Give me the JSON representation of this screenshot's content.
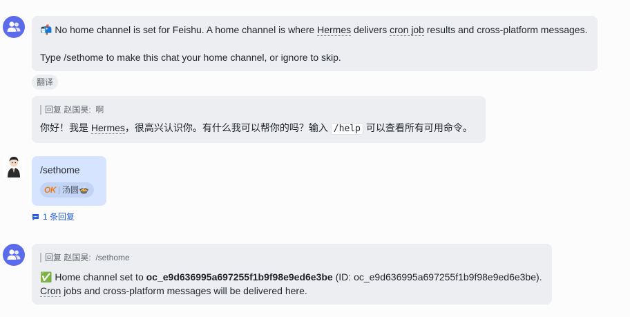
{
  "messages": [
    {
      "id": "bot-msg-1",
      "line1_icon": "📬",
      "line1_a": " No home channel is set for Feishu. A home channel is where ",
      "line1_term1": "Hermes",
      "line1_b": " delivers ",
      "line1_term2": "cron job",
      "line1_c": " results and cross-platform messages.",
      "line2": "Type /sethome to make this chat your home channel, or ignore to skip.",
      "translate_label": "翻译"
    },
    {
      "id": "bot-msg-2",
      "quote_prefix": "回复 赵国昊:",
      "quote_text": "啊",
      "text_a": "你好！我是 ",
      "text_term": "Hermes",
      "text_b": "，很高兴认识你。有什么我可以帮你的吗？输入 ",
      "text_code": "/help",
      "text_c": " 可以查看所有可用命令。"
    },
    {
      "id": "user-msg-1",
      "text": "/sethome",
      "reaction_badge": "OK",
      "reaction_user": "汤圆🍲",
      "thread_label": "1 条回复"
    },
    {
      "id": "bot-msg-3",
      "quote_prefix": "回复 赵国昊:",
      "quote_text": "/sethome",
      "line1_icon": "✅",
      "line1_a": " Home channel set to ",
      "line1_bold": "oc_e9d636995a697255f1b9f98e9ed6e3be",
      "line1_b": " (ID: oc_e9d636995a697255f1b9f98e9ed6e3be).",
      "line2_term": "Cron",
      "line2_rest": " jobs and cross-platform messages will be delivered here."
    }
  ],
  "colors": {
    "bot_avatar": "#5b6bea",
    "bot_bubble": "#eceef1",
    "user_bubble": "#d6e4ff",
    "link": "#245bdb"
  }
}
